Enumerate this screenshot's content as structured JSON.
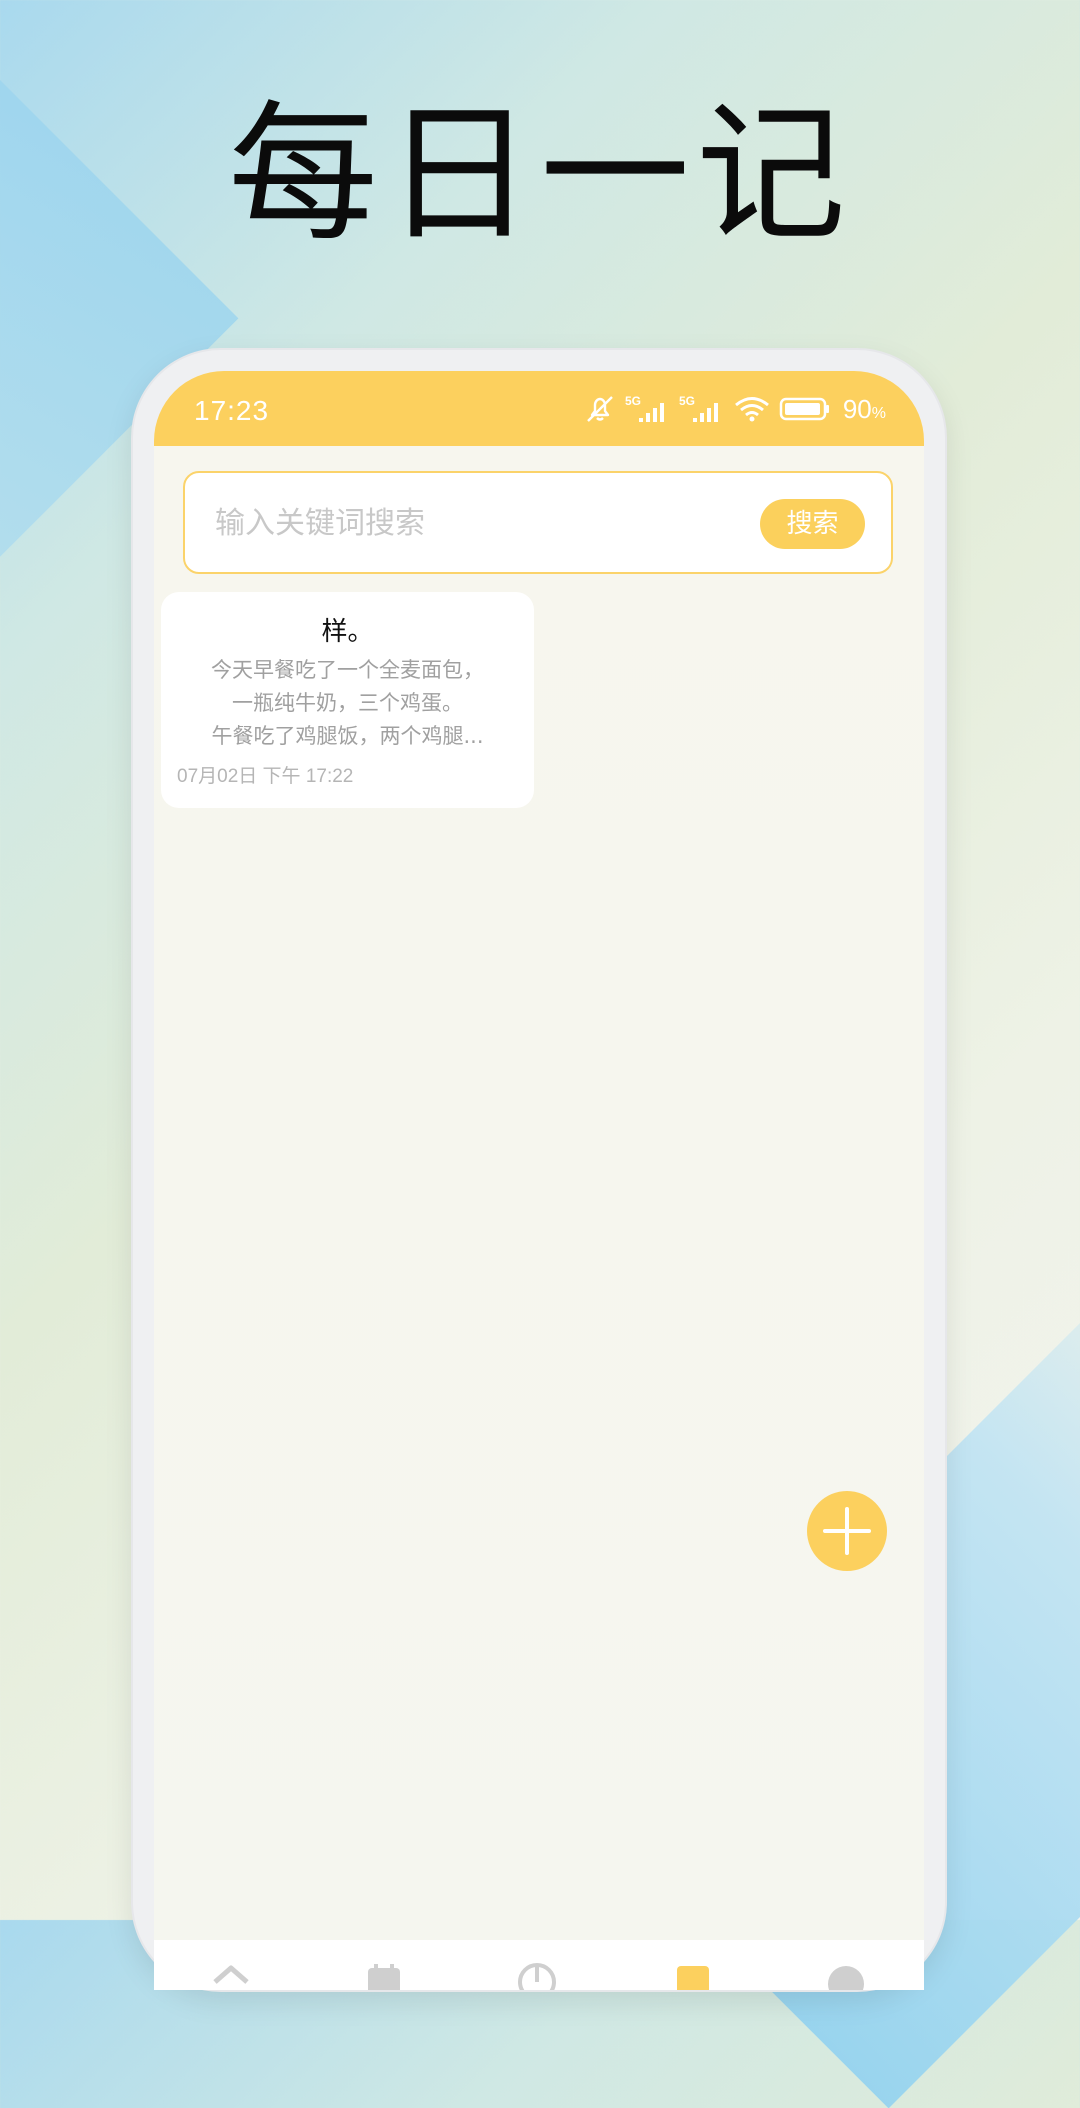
{
  "headline": "每日一记",
  "status_bar": {
    "time": "17:23",
    "battery_percent": "90",
    "battery_unit": "%",
    "icons": [
      "mute-bell-icon",
      "signal-5g-icon",
      "signal-5g-icon",
      "wifi-icon",
      "battery-icon"
    ]
  },
  "search": {
    "placeholder": "输入关键词搜索",
    "button_label": "搜索"
  },
  "notes": [
    {
      "title": "样。",
      "preview_lines": [
        "今天早餐吃了一个全麦面包，",
        "一瓶纯牛奶，三个鸡蛋。",
        "午餐吃了鸡腿饭，两个鸡腿..."
      ],
      "date": "07月02日 下午 17:22"
    }
  ],
  "fab": {
    "icon": "plus-icon"
  },
  "bottom_nav": {
    "items": [
      "home-icon",
      "calendar-icon",
      "chart-icon",
      "note-icon",
      "profile-icon"
    ],
    "active_index": 3
  },
  "colors": {
    "accent": "#fcd05e",
    "background": "#f6f6ee",
    "muted_text": "#a0a0a0"
  }
}
